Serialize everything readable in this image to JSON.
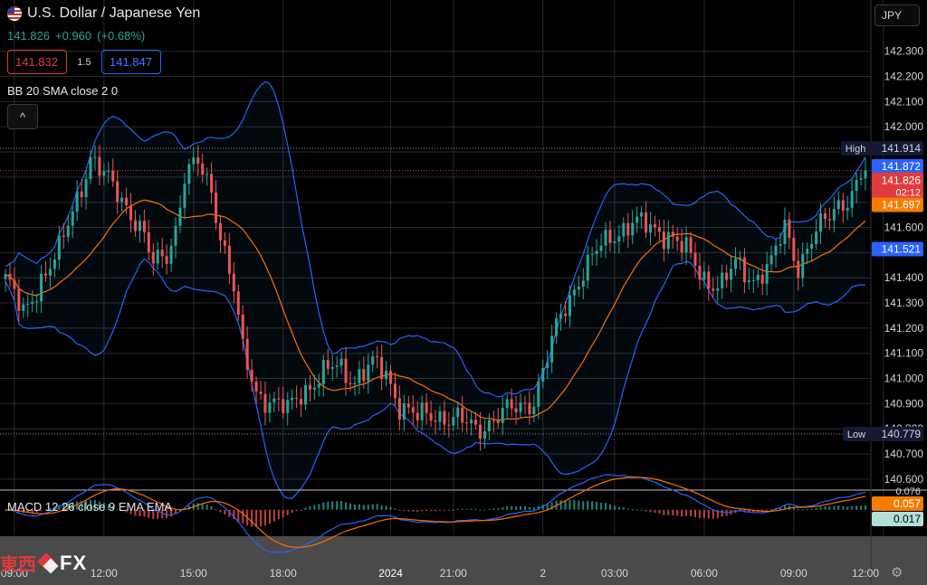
{
  "header": {
    "symbol": "U.S. Dollar / Japanese Yen",
    "last": "141.826",
    "change": "+0.960",
    "change_pct": "(+0.68%)",
    "bid": "141.832",
    "spread": "1.5",
    "ask": "141.847",
    "currency_button": "JPY"
  },
  "indicators": {
    "bb_label": "BB 20 SMA close 2 0",
    "macd_label": "MACD 12 26 close 9 EMA EMA"
  },
  "toolbar": {
    "collapse_glyph": "^",
    "settings_icon": "gear-icon"
  },
  "logo": {
    "cjk": "東西",
    "fx": "FX"
  },
  "colors": {
    "up": "#26a69a",
    "down": "#ef5350",
    "bb_band": "#2962ff",
    "bb_basis": "#ff6d00",
    "macd_line": "#2962ff",
    "signal_line": "#ff6d00",
    "last_price": "#e03a3e"
  },
  "chart_data": {
    "type": "candlestick",
    "instrument": "USD/JPY",
    "y_axis": {
      "ticks": [
        "142.300",
        "142.200",
        "142.100",
        "142.000",
        "141.900",
        "141.800",
        "141.700",
        "141.600",
        "141.500",
        "141.400",
        "141.300",
        "141.200",
        "141.100",
        "141.000",
        "140.900",
        "140.800",
        "140.700",
        "140.600"
      ],
      "ylim": [
        140.56,
        142.36
      ]
    },
    "x_axis": {
      "ticks": [
        "09:00",
        "12:00",
        "15:00",
        "18:00",
        "2024",
        "21:00",
        "2",
        "03:00",
        "06:00",
        "09:00",
        "12:00"
      ],
      "tick_bars": [
        2,
        22,
        42,
        62,
        86,
        100,
        120,
        136,
        156,
        176,
        196
      ]
    },
    "price_labels": [
      {
        "name": "High",
        "label": "High",
        "value": "141.914"
      },
      {
        "name": "bb-upper",
        "value": "141.872"
      },
      {
        "name": "last",
        "value": "141.826",
        "sub": "02:12"
      },
      {
        "name": "bb-basis",
        "value": "141.697"
      },
      {
        "name": "bb-lower",
        "value": "141.521"
      },
      {
        "name": "Low",
        "label": "Low",
        "value": "140.779"
      }
    ],
    "macd": {
      "ticks": [
        "0.076"
      ],
      "labels": [
        {
          "name": "macd",
          "value": "0.057"
        },
        {
          "name": "signal",
          "value": "0.017"
        }
      ],
      "ylim": [
        -0.12,
        0.08
      ]
    },
    "anchors": [
      [
        0,
        141.4
      ],
      [
        4,
        141.25
      ],
      [
        8,
        141.4
      ],
      [
        12,
        141.5
      ],
      [
        16,
        141.72
      ],
      [
        19,
        141.88
      ],
      [
        22,
        141.8
      ],
      [
        26,
        141.72
      ],
      [
        30,
        141.6
      ],
      [
        33,
        141.45
      ],
      [
        36,
        141.5
      ],
      [
        38,
        141.6
      ],
      [
        40,
        141.8
      ],
      [
        43,
        141.85
      ],
      [
        46,
        141.75
      ],
      [
        48,
        141.58
      ],
      [
        51,
        141.35
      ],
      [
        53,
        141.1
      ],
      [
        56,
        140.95
      ],
      [
        60,
        140.9
      ],
      [
        63,
        140.87
      ],
      [
        66,
        140.95
      ],
      [
        70,
        141.0
      ],
      [
        74,
        141.05
      ],
      [
        78,
        141.0
      ],
      [
        82,
        141.05
      ],
      [
        85,
        141.02
      ],
      [
        88,
        140.9
      ],
      [
        92,
        140.84
      ],
      [
        96,
        140.86
      ],
      [
        100,
        140.84
      ],
      [
        105,
        140.8
      ],
      [
        110,
        140.85
      ],
      [
        114,
        140.88
      ],
      [
        118,
        140.92
      ],
      [
        121,
        141.08
      ],
      [
        124,
        141.25
      ],
      [
        128,
        141.4
      ],
      [
        132,
        141.5
      ],
      [
        136,
        141.58
      ],
      [
        140,
        141.62
      ],
      [
        143,
        141.6
      ],
      [
        148,
        141.58
      ],
      [
        152,
        141.5
      ],
      [
        156,
        141.4
      ],
      [
        160,
        141.37
      ],
      [
        163,
        141.45
      ],
      [
        167,
        141.4
      ],
      [
        171,
        141.45
      ],
      [
        174,
        141.6
      ],
      [
        177,
        141.45
      ],
      [
        180,
        141.55
      ],
      [
        183,
        141.62
      ],
      [
        186,
        141.7
      ],
      [
        189,
        141.73
      ],
      [
        191,
        141.8
      ],
      [
        192,
        141.826
      ]
    ],
    "n_bars": 193
  }
}
